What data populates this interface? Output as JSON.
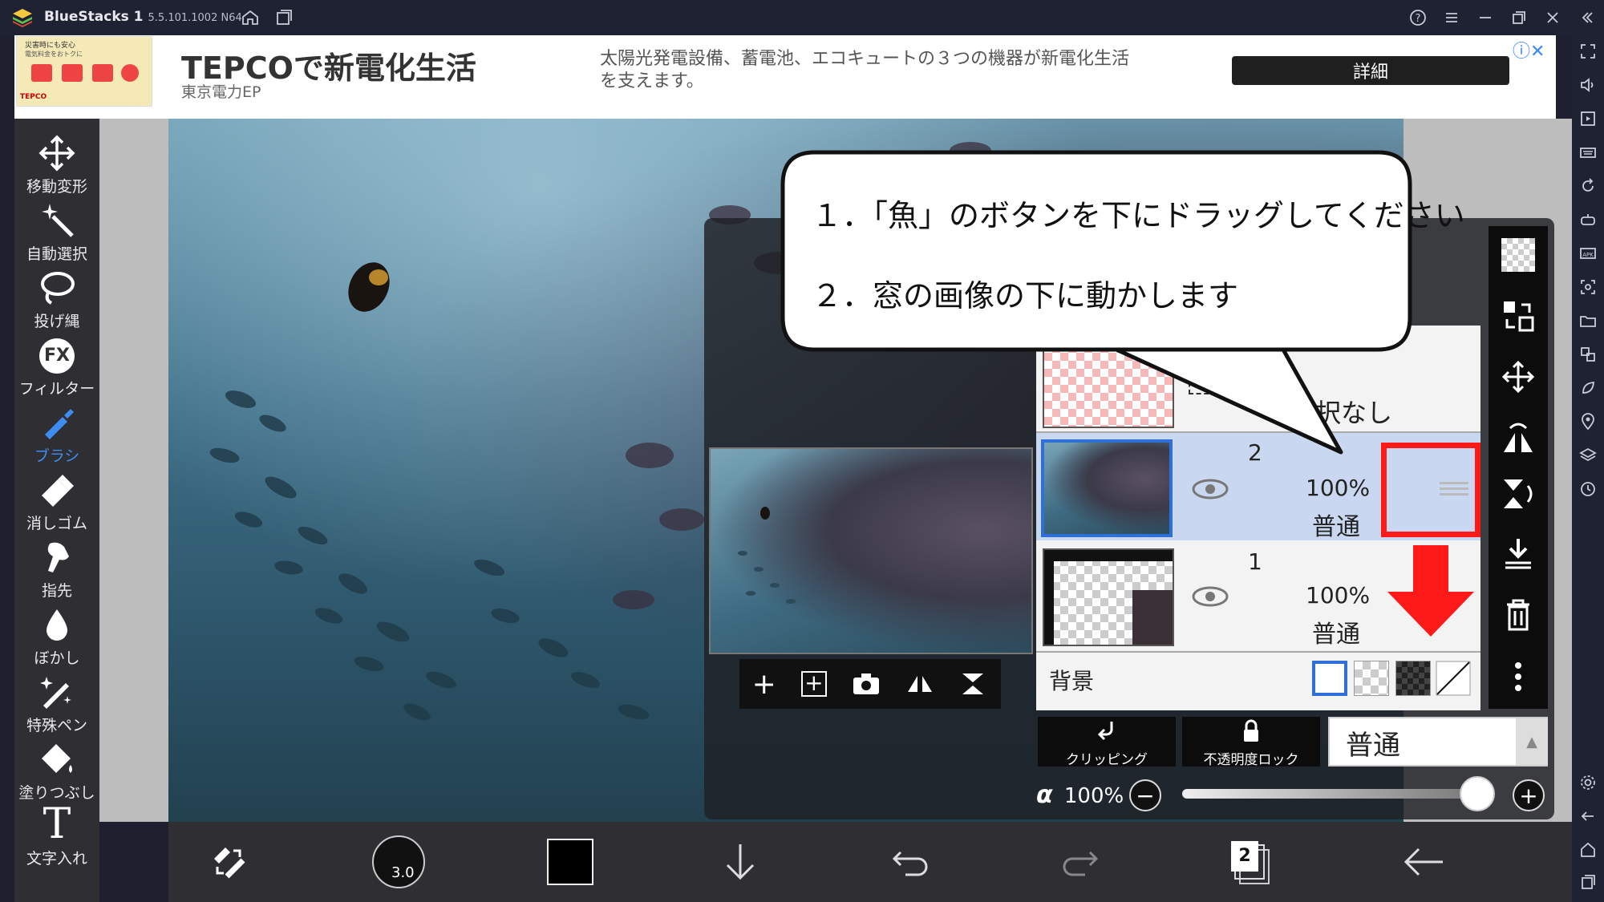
{
  "window": {
    "app_name": "BlueStacks 1",
    "version": "5.5.101.1002 N64"
  },
  "ad": {
    "title": "TEPCOで新電化生活",
    "advertiser": "東京電力EP",
    "description": "太陽光発電設備、蓄電池、エコキュートの３つの機器が新電化生活を支えます。",
    "button_label": "詳細",
    "image_lines": [
      "災害時にも安心",
      "電気料金をおトクに",
      "TEPCO"
    ]
  },
  "tools": [
    {
      "label": "移動変形",
      "icon": "move-icon"
    },
    {
      "label": "自動選択",
      "icon": "magic-wand-icon"
    },
    {
      "label": "投げ縄",
      "icon": "lasso-icon"
    },
    {
      "label": "フィルター",
      "icon": "fx-icon",
      "icon_text": "FX"
    },
    {
      "label": "ブラシ",
      "icon": "brush-icon",
      "active": true
    },
    {
      "label": "消しゴム",
      "icon": "eraser-icon"
    },
    {
      "label": "指先",
      "icon": "finger-icon"
    },
    {
      "label": "ぼかし",
      "icon": "blur-icon"
    },
    {
      "label": "特殊ペン",
      "icon": "special-pen-icon"
    },
    {
      "label": "塗りつぶし",
      "icon": "fill-icon"
    },
    {
      "label": "文字入れ",
      "icon": "text-icon",
      "icon_text": "T"
    }
  ],
  "bottom_bar": {
    "brush_size": "3.0",
    "layer_count": "2",
    "color": "#000000"
  },
  "instruction": {
    "line1": "１．「魚」のボタンを下にドラッグしてください",
    "line2": "２．窓の画像の下に動かします"
  },
  "layers": {
    "top_partial_text": "択なし",
    "items": [
      {
        "number": "2",
        "opacity": "100%",
        "mode": "普通",
        "selected": true
      },
      {
        "number": "1",
        "opacity": "100%",
        "mode": "普通",
        "selected": false
      }
    ],
    "background_label": "背景"
  },
  "controls": {
    "clipping_label": "クリッピング",
    "lock_label": "不透明度ロック",
    "blend_mode": "普通",
    "alpha_symbol": "α",
    "alpha_value": "100%",
    "alpha_level": 1.0
  },
  "colors": {
    "highlight": "#ff1a1a",
    "active_tool": "#3f8cf0",
    "selected_layer": "#c9d8f0"
  }
}
